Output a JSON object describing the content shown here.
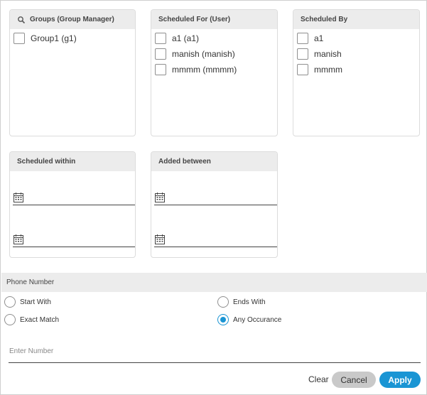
{
  "colors": {
    "accent": "#1a95d4",
    "header_bg": "#ececec",
    "cancel_bg": "#c9c9c9"
  },
  "groups": {
    "title": "Groups (Group Manager)",
    "icon": "search-icon",
    "items": [
      {
        "label": "Group1 (g1)",
        "checked": false
      }
    ]
  },
  "scheduled_for": {
    "title": "Scheduled For (User)",
    "items": [
      {
        "label": "a1 (a1)",
        "checked": false
      },
      {
        "label": "manish (manish)",
        "checked": false
      },
      {
        "label": "mmmm (mmmm)",
        "checked": false
      }
    ]
  },
  "scheduled_by": {
    "title": "Scheduled By",
    "items": [
      {
        "label": "a1",
        "checked": false
      },
      {
        "label": "manish",
        "checked": false
      },
      {
        "label": "mmmm",
        "checked": false
      }
    ]
  },
  "scheduled_within": {
    "title": "Scheduled within",
    "icon": "calendar-icon",
    "from_value": "",
    "to_value": ""
  },
  "added_between": {
    "title": "Added between",
    "icon": "calendar-icon",
    "from_value": "",
    "to_value": ""
  },
  "phone": {
    "title": "Phone Number",
    "options": [
      {
        "label": "Start With",
        "checked": false
      },
      {
        "label": "Ends With",
        "checked": false
      },
      {
        "label": "Exact Match",
        "checked": false
      },
      {
        "label": "Any Occurance",
        "checked": true
      }
    ],
    "input_value": "",
    "placeholder": "Enter Number"
  },
  "actions": {
    "clear": "Clear",
    "cancel": "Cancel",
    "apply": "Apply"
  }
}
